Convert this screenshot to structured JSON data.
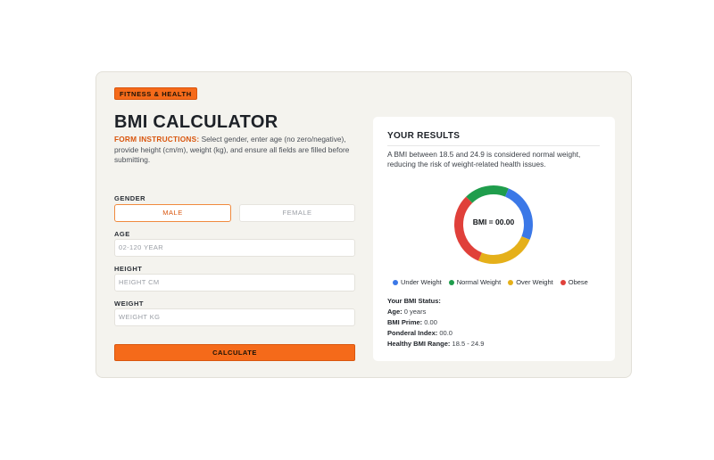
{
  "tag": "FITNESS & HEALTH",
  "title": "BMI CALCULATOR",
  "instructions": {
    "lead": "FORM INSTRUCTIONS:",
    "text": " Select gender, enter age (no zero/negative), provide height (cm/m), weight (kg), and ensure all fields are filled before submitting."
  },
  "form": {
    "gender_label": "GENDER",
    "male_label": "MALE",
    "female_label": "FEMALE",
    "age_label": "AGE",
    "age_placeholder": "02-120 YEAR",
    "height_label": "HEIGHT",
    "height_placeholder": "HEIGHT CM",
    "weight_label": "WEIGHT",
    "weight_placeholder": "WEIGHT KG",
    "calculate_label": "CALCULATE"
  },
  "results": {
    "title": "YOUR RESULTS",
    "description": "A BMI between 18.5 and 24.9 is considered normal weight, reducing the risk of weight-related health issues.",
    "bmi_display": "BMI = 00.00",
    "legend": [
      {
        "label": "Under Weight",
        "color": "#3b78e7"
      },
      {
        "label": "Normal Weight",
        "color": "#1f9d4c"
      },
      {
        "label": "Over Weight",
        "color": "#e5b01a"
      },
      {
        "label": "Obese",
        "color": "#e0403a"
      }
    ],
    "status_heading": "Your BMI Status:",
    "stats": [
      {
        "key": "Age:",
        "value": " 0 years"
      },
      {
        "key": "BMI Prime:",
        "value": " 0.00"
      },
      {
        "key": "Ponderal Index:",
        "value": " 00.0"
      },
      {
        "key": "Healthy BMI Range:",
        "value": " 18.5 - 24.9"
      }
    ]
  },
  "colors": {
    "accent": "#f56a1a",
    "under": "#3b78e7",
    "normal": "#1f9d4c",
    "over": "#e5b01a",
    "obese": "#e0403a"
  }
}
